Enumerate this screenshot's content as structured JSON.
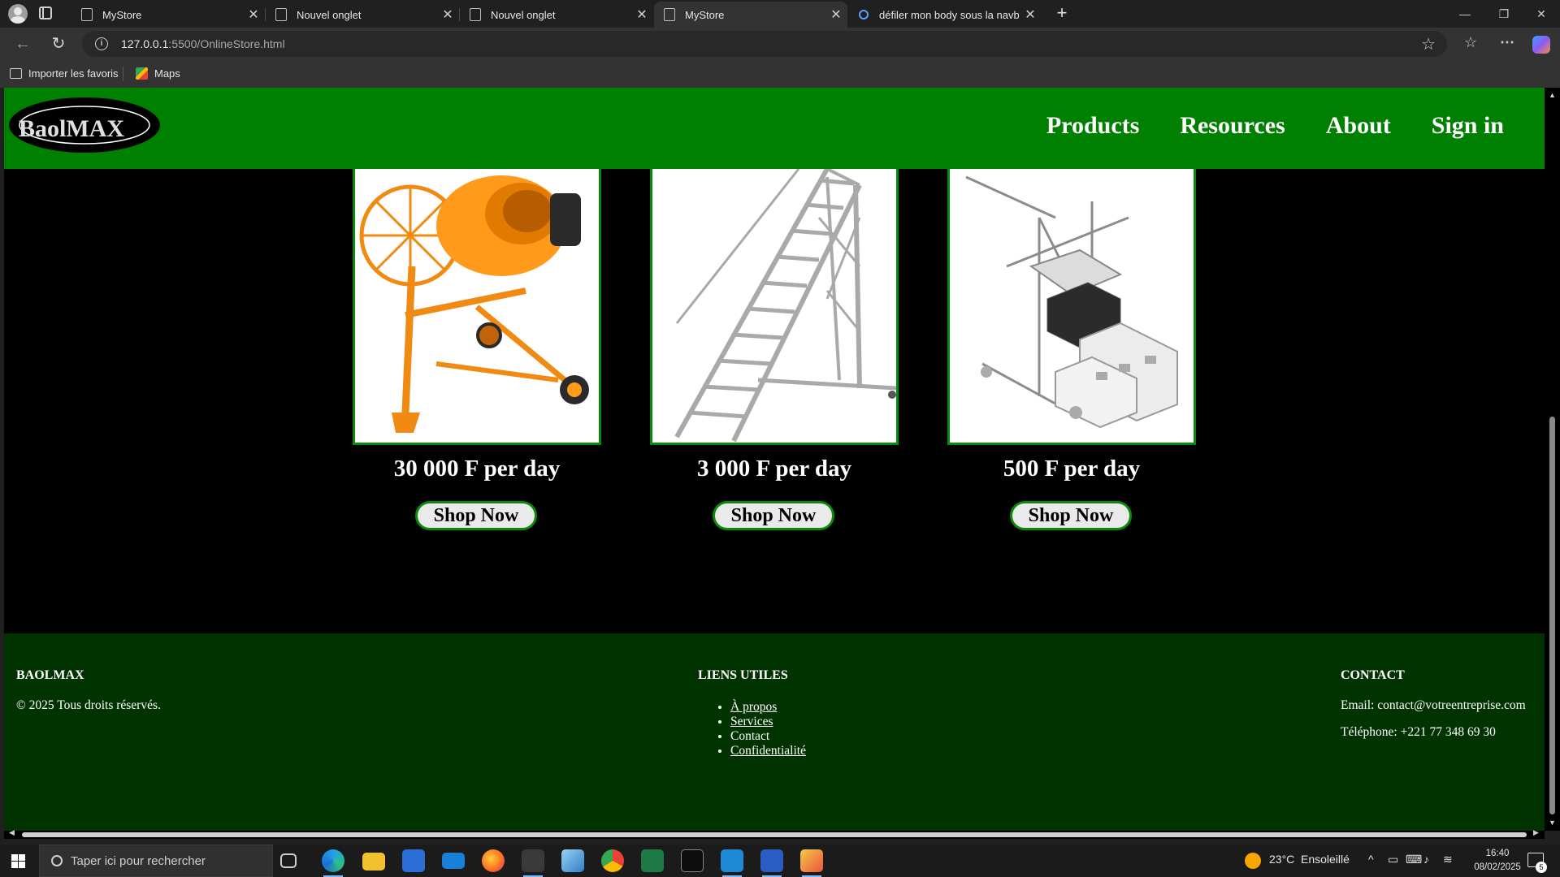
{
  "browser": {
    "tabs": [
      {
        "label": "MyStore",
        "close": "✕"
      },
      {
        "label": "Nouvel onglet",
        "close": "✕"
      },
      {
        "label": "Nouvel onglet",
        "close": "✕"
      },
      {
        "label": "MyStore",
        "close": "✕"
      },
      {
        "label": "défiler mon body sous la navbar",
        "close": "✕"
      }
    ],
    "active_tab": 3,
    "url_host": "127.0.0.1",
    "url_rest": ":5500/OnlineStore.html",
    "favorites": [
      {
        "label": "Importer les favoris"
      },
      {
        "label": "Maps"
      }
    ]
  },
  "site": {
    "logo_text": "BaolMAX",
    "nav": [
      "Products",
      "Resources",
      "About",
      "Sign in"
    ],
    "products": [
      {
        "price": "30 000 F per day",
        "button": "Shop Now",
        "image": "concrete-mixer-image"
      },
      {
        "price": "3 000 F per day",
        "button": "Shop Now",
        "image": "rolling-ladder-image"
      },
      {
        "price": "500 F per day",
        "button": "Shop Now",
        "image": "block-machine-image"
      }
    ],
    "footer": {
      "brand_title": "BAOLMAX",
      "copyright": "© 2025 Tous droits réservés.",
      "links_title": "LIENS UTILES",
      "links": [
        "À propos",
        "Services",
        "Contact",
        "Confidentialité"
      ],
      "contact_title": "CONTACT",
      "email": "Email: contact@votreentreprise.com",
      "phone": "Téléphone: +221 77 348 69 30"
    },
    "colors": {
      "navbar": "#008000",
      "footer": "#003300",
      "card_border": "#0a8a0a",
      "page_bg": "#000000"
    }
  },
  "taskbar": {
    "search_placeholder": "Taper ici pour rechercher",
    "weather_temp": "23°C",
    "weather_text": "Ensoleillé",
    "time": "16:40",
    "date": "08/02/2025",
    "notifications": "5"
  }
}
